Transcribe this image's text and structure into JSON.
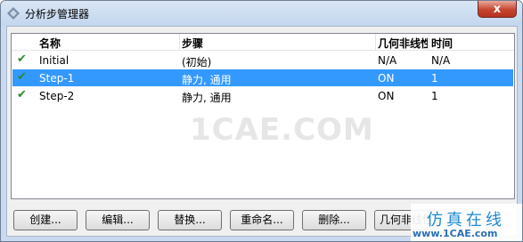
{
  "window": {
    "title": "分析步管理器",
    "close_label": "x"
  },
  "table": {
    "headers": {
      "name": "名称",
      "step": "步骤",
      "nlgeom": "几何非线性",
      "time": "时间"
    },
    "rows": [
      {
        "name": "Initial",
        "step": "(初始)",
        "nlgeom": "N/A",
        "time": "N/A",
        "checked": true,
        "selected": false
      },
      {
        "name": "Step-1",
        "step": "静力, 通用",
        "nlgeom": "ON",
        "time": "1",
        "checked": true,
        "selected": true
      },
      {
        "name": "Step-2",
        "step": "静力, 通用",
        "nlgeom": "ON",
        "time": "1",
        "checked": true,
        "selected": false
      }
    ]
  },
  "watermark": "1CAE.COM",
  "buttons": {
    "create": "创建...",
    "edit": "编辑...",
    "replace": "替换...",
    "rename": "重命名...",
    "delete": "删除...",
    "nlgeom": "几何非线性"
  },
  "brand": {
    "top": "仿真在线",
    "bottom": "www.1CAE.com"
  },
  "icons": {
    "check": "check-icon",
    "app": "app-icon",
    "close": "close-icon"
  },
  "colors": {
    "selection": "#3399ff",
    "check": "#2c8a2c",
    "close": "#c6452f"
  }
}
